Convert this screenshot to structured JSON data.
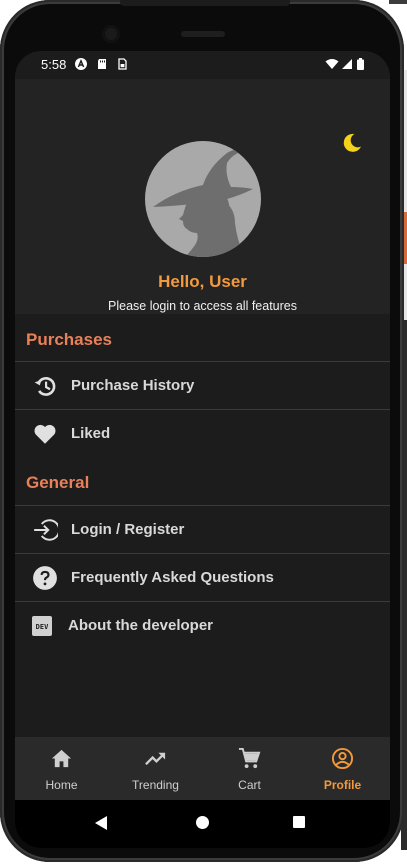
{
  "status_bar": {
    "time": "5:58",
    "left_icons": [
      "a-circle-icon",
      "sd-card-icon",
      "sim-icon"
    ],
    "right_icons": [
      "wifi-icon",
      "signal-icon",
      "battery-icon"
    ]
  },
  "header": {
    "theme_toggle_icon": "moon-icon",
    "theme_icon_color": "#f4d21a",
    "greeting": "Hello, User",
    "subtitle": "Please login to access all features"
  },
  "sections": {
    "purchases": {
      "title": "Purchases",
      "items": [
        {
          "label": "Purchase History",
          "icon": "history-icon"
        },
        {
          "label": "Liked",
          "icon": "heart-icon"
        }
      ]
    },
    "general": {
      "title": "General",
      "items": [
        {
          "label": "Login / Register",
          "icon": "login-icon"
        },
        {
          "label": "Frequently Asked Questions",
          "icon": "help-icon"
        },
        {
          "label": "About the developer",
          "icon": "dev-badge-icon",
          "icon_text": "DEV"
        }
      ]
    }
  },
  "bottom_nav": {
    "items": [
      {
        "label": "Home",
        "icon": "home-icon"
      },
      {
        "label": "Trending",
        "icon": "trending-icon"
      },
      {
        "label": "Cart",
        "icon": "cart-icon"
      },
      {
        "label": "Profile",
        "icon": "profile-icon",
        "active": true
      }
    ]
  },
  "colors": {
    "accent": "#f29a3d",
    "section_title": "#e8805a",
    "screen_bg": "#1c1c1c",
    "header_bg": "#232323"
  }
}
